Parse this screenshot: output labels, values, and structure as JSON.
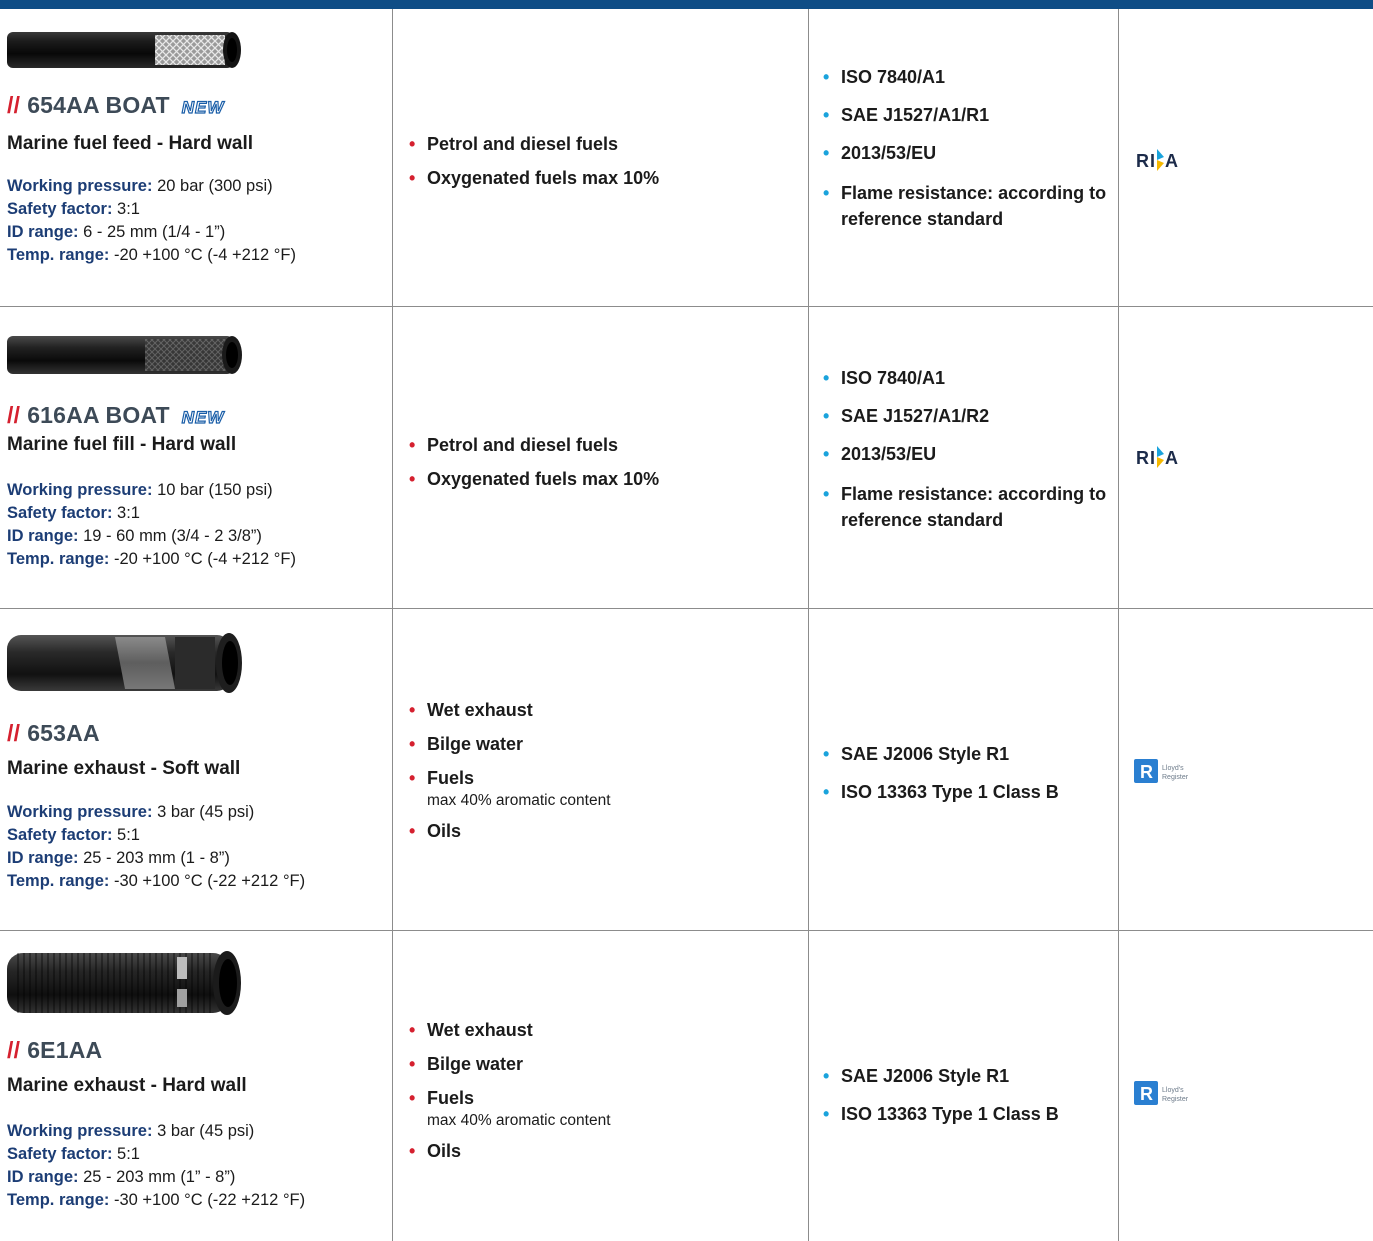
{
  "products": [
    {
      "code": "654AA BOAT",
      "badge": "NEW",
      "subtitle": "Marine fuel feed - Hard wall",
      "specs": [
        {
          "label": "Working pressure:",
          "value": "20 bar (300 psi)"
        },
        {
          "label": "Safety factor:",
          "value": "3:1"
        },
        {
          "label": "ID range:",
          "value": "6 - 25 mm (1/4 - 1”)"
        },
        {
          "label": "Temp. range:",
          "value": "-20 +100 °C (-4 +212 °F)"
        }
      ],
      "applications": [
        "Petrol and diesel fuels",
        "Oxygenated fuels max 10%"
      ],
      "standards": [
        "ISO 7840/A1",
        "SAE J1527/A1/R1",
        "2013/53/EU",
        "Flame resistance: according to reference standard"
      ],
      "approval_logo": "RINA",
      "hose_icon": "braided-hose-icon"
    },
    {
      "code": "616AA BOAT",
      "badge": "NEW",
      "subtitle": "Marine fuel fill - Hard wall",
      "specs": [
        {
          "label": "Working pressure:",
          "value": "10 bar (150 psi)"
        },
        {
          "label": "Safety factor:",
          "value": "3:1"
        },
        {
          "label": "ID range:",
          "value": "19 - 60 mm (3/4 - 2 3/8”)"
        },
        {
          "label": "Temp. range:",
          "value": "-20 +100 °C (-4 +212 °F)"
        }
      ],
      "applications": [
        "Petrol and diesel fuels",
        "Oxygenated fuels max 10%"
      ],
      "standards": [
        "ISO 7840/A1",
        "SAE J1527/A1/R2",
        "2013/53/EU",
        "Flame resistance: according to reference standard"
      ],
      "approval_logo": "RINA",
      "hose_icon": "fill-hose-icon"
    },
    {
      "code": "653AA",
      "badge": "",
      "subtitle": "Marine exhaust - Soft wall",
      "specs": [
        {
          "label": "Working pressure:",
          "value": "3 bar (45 psi)"
        },
        {
          "label": "Safety factor:",
          "value": "5:1"
        },
        {
          "label": "ID range:",
          "value": "25 - 203 mm (1 - 8”)"
        },
        {
          "label": "Temp. range:",
          "value": "-30 +100 °C (-22 +212 °F)"
        }
      ],
      "applications": [
        {
          "name": "Wet exhaust"
        },
        {
          "name": "Bilge water"
        },
        {
          "name": "Fuels",
          "note": "max 40% aromatic content"
        },
        {
          "name": "Oils"
        }
      ],
      "standards": [
        "SAE J2006 Style R1",
        "ISO 13363 Type 1 Class B"
      ],
      "approval_logo": "Lloyd's Register",
      "hose_icon": "exhaust-hose-icon"
    },
    {
      "code": "6E1AA",
      "badge": "",
      "subtitle": "Marine exhaust - Hard wall",
      "specs": [
        {
          "label": "Working pressure:",
          "value": "3 bar (45 psi)"
        },
        {
          "label": "Safety factor:",
          "value": "5:1"
        },
        {
          "label": "ID range:",
          "value": "25 - 203 mm (1” - 8”)"
        },
        {
          "label": "Temp. range:",
          "value": "-30 +100 °C (-22 +212 °F)"
        }
      ],
      "applications": [
        {
          "name": "Wet exhaust"
        },
        {
          "name": "Bilge water"
        },
        {
          "name": "Fuels",
          "note": "max 40% aromatic content"
        },
        {
          "name": "Oils"
        }
      ],
      "standards": [
        "SAE J2006 Style R1",
        "ISO 13363 Type 1 Class B"
      ],
      "approval_logo": "Lloyd's Register",
      "hose_icon": "corrugated-hose-icon"
    }
  ],
  "code_prefix": "//",
  "colors": {
    "header_bar": "#0f4d86",
    "accent_red": "#d5202f",
    "accent_blue": "#1aa3dc",
    "label_blue": "#1c3d75"
  }
}
